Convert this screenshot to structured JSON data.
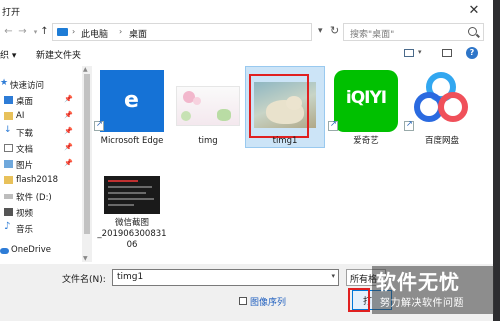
{
  "window": {
    "title": "打开"
  },
  "navigation": {
    "breadcrumb": [
      "此电脑",
      "桌面"
    ],
    "search_placeholder": "搜索\"桌面\""
  },
  "toolbar": {
    "organize_label": "织 ▾",
    "new_folder_label": "新建文件夹"
  },
  "sidebar": {
    "items": [
      {
        "label": "快速访问",
        "icon": "star-icon",
        "pinned": false
      },
      {
        "label": "桌面",
        "icon": "desktop-icon",
        "pinned": true
      },
      {
        "label": "AI",
        "icon": "folder-icon",
        "pinned": true
      },
      {
        "label": "下载",
        "icon": "download-icon",
        "pinned": true
      },
      {
        "label": "文档",
        "icon": "document-icon",
        "pinned": true
      },
      {
        "label": "图片",
        "icon": "picture-icon",
        "pinned": true
      },
      {
        "label": "flash2018",
        "icon": "folder-icon",
        "pinned": false
      },
      {
        "label": "软件 (D:)",
        "icon": "drive-icon",
        "pinned": false
      },
      {
        "label": "视频",
        "icon": "video-icon",
        "pinned": false
      },
      {
        "label": "音乐",
        "icon": "music-icon",
        "pinned": false
      },
      {
        "label": "OneDrive",
        "icon": "cloud-icon",
        "pinned": false
      }
    ]
  },
  "files": [
    {
      "name": "Microsoft Edge",
      "kind": "shortcut",
      "icon": "edge-icon"
    },
    {
      "name": "timg",
      "kind": "image"
    },
    {
      "name": "timg1",
      "kind": "image",
      "selected": true
    },
    {
      "name": "爱奇艺",
      "kind": "shortcut",
      "icon": "iqiyi-icon",
      "icon_text": "iQIYI"
    },
    {
      "name": "百度网盘",
      "kind": "shortcut",
      "icon": "baidu-netdisk-icon"
    },
    {
      "name": "微信截图_20190630083106",
      "name_lines": [
        "微信截图",
        "_201906300831",
        "06"
      ],
      "kind": "image"
    }
  ],
  "footer": {
    "filename_label": "文件名(N):",
    "filename_value": "timg1",
    "filetype_value": "所有格",
    "image_sequence_label": "图像序列",
    "open_label": "打"
  },
  "watermark": {
    "title": "软件无忧",
    "subtitle": "努力解决软件问题"
  },
  "colors": {
    "accent": "#0078d7",
    "selection": "#cce4f7",
    "highlight_box": "#e02020",
    "iqiyi_green": "#00c000",
    "edge_blue": "#1572d6"
  }
}
